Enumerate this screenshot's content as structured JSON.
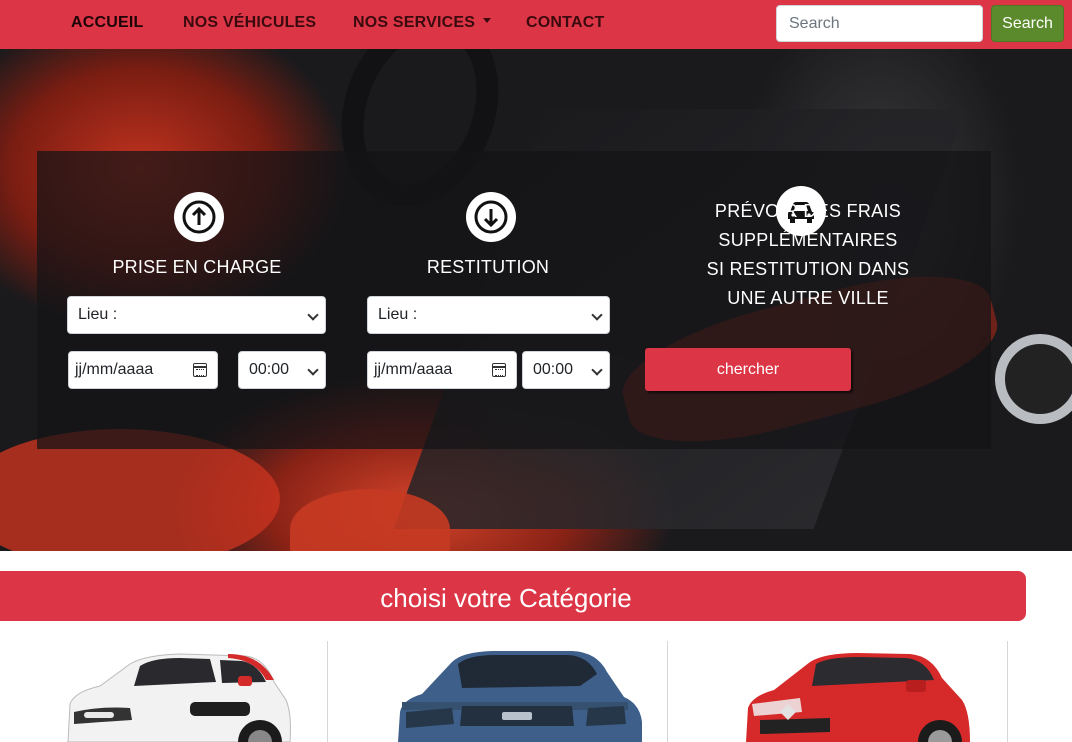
{
  "nav": {
    "items": [
      {
        "label": "ACCUEIL"
      },
      {
        "label": "NOS VÉHICULES"
      },
      {
        "label": "NOS SERVICES"
      },
      {
        "label": "CONTACT"
      }
    ],
    "search_placeholder": "Search",
    "search_button": "Search"
  },
  "form": {
    "pickup": {
      "title": "PRISE EN CHARGE",
      "location": "Lieu :",
      "date": "jj/mm/aaaa",
      "time": "00:00"
    },
    "return": {
      "title": "RESTITUTION",
      "location": "Lieu :",
      "date": "jj/mm/aaaa",
      "time": "00:00"
    },
    "info_lines": [
      "PRÉVOIR DES FRAIS SUPPLÉMENTAIRES",
      "SI RESTITUTION DANS",
      "UNE AUTRE VILLE"
    ],
    "submit": "chercher"
  },
  "category": {
    "title": "choisi votre Catégorie"
  },
  "colors": {
    "brand_red": "#dc3545",
    "search_green": "#5a8a2b"
  },
  "icons": [
    "arrow-up-circle-icon",
    "arrow-down-circle-icon",
    "car-icon",
    "calendar-icon",
    "chevron-down-icon"
  ]
}
